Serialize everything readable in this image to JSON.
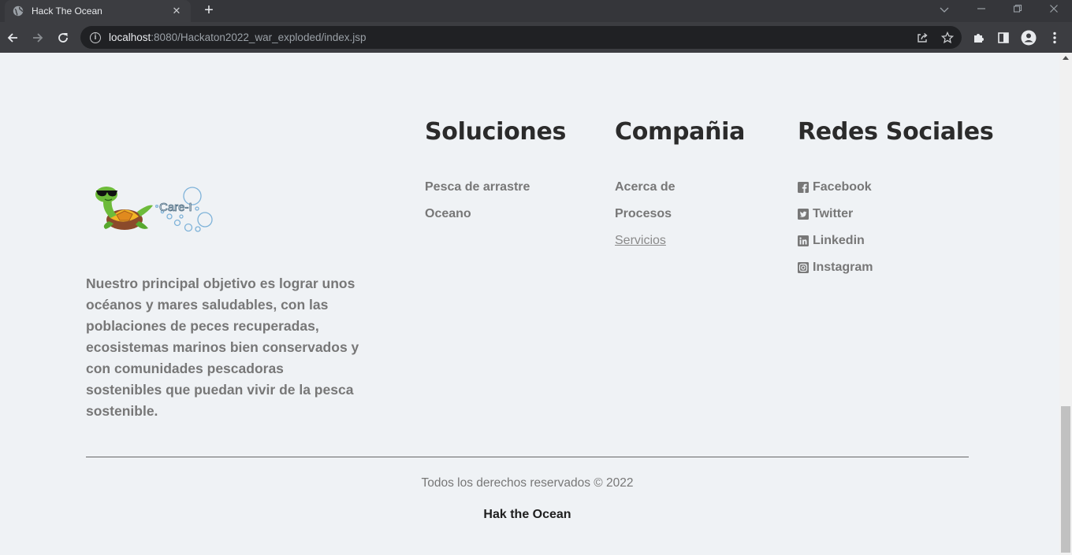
{
  "browser": {
    "tab_title": "Hack The Ocean",
    "tab_close": "✕",
    "new_tab": "+",
    "url_host": "localhost",
    "url_path": ":8080/Hackaton2022_war_exploded/index.jsp",
    "icons": [
      "globe-icon",
      "back-icon",
      "forward-icon",
      "reload-icon",
      "info-icon",
      "share-icon",
      "star-icon",
      "extensions-icon",
      "side-panel-icon",
      "profile-icon",
      "menu-icon"
    ]
  },
  "footer": {
    "logo_text": "Care-I",
    "description": "Nuestro principal objetivo es lograr unos océanos y mares saludables, con las poblaciones de peces recuperadas, ecosistemas marinos bien conservados y con comunidades pescadoras sostenibles que puedan vivir de la pesca sostenible.",
    "columns": [
      {
        "title": "Soluciones",
        "items": [
          "Pesca de arrastre",
          "Oceano"
        ]
      },
      {
        "title": "Compañia",
        "items": [
          "Acerca de",
          "Procesos",
          "Servicios"
        ]
      },
      {
        "title": "Redes Sociales",
        "items": [
          "Facebook",
          "Twitter",
          "Linkedin",
          "Instagram"
        ]
      }
    ],
    "copyright": "Todos los derechos reservados © 2022",
    "brand": "Hak the Ocean"
  },
  "colors": {
    "page_background": "#eff2f5",
    "heading": "#2b2b2b",
    "muted_text": "#777777",
    "chrome_dark": "#35363a"
  }
}
